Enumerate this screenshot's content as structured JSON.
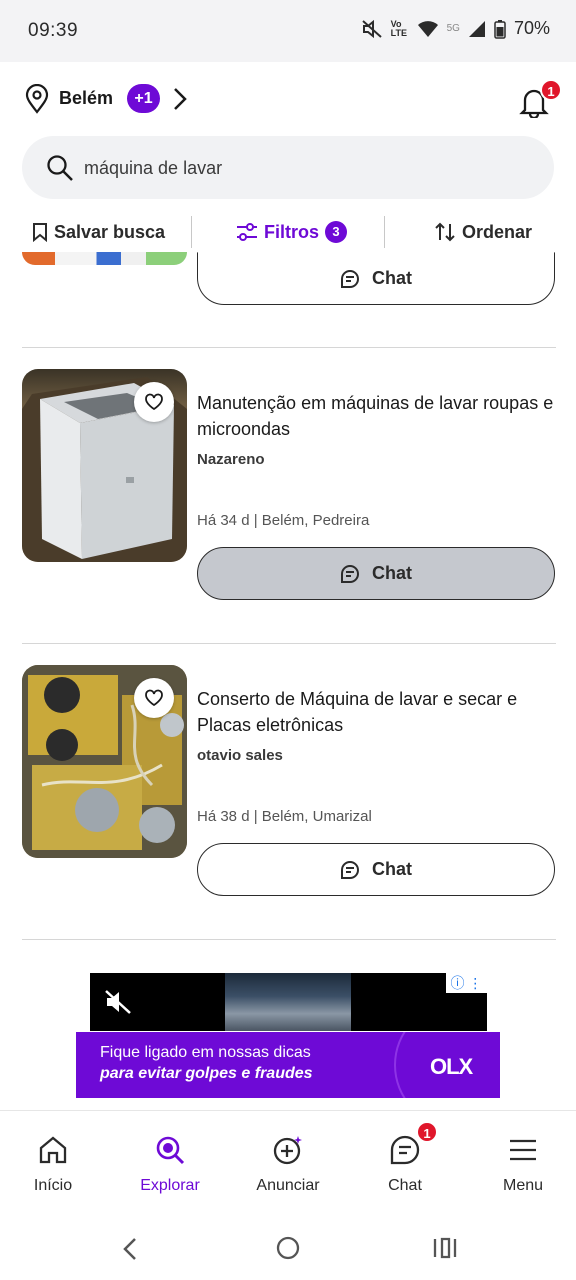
{
  "status_bar": {
    "time": "09:39",
    "network": "5G",
    "volte": "Vo LTE",
    "battery": "70%"
  },
  "header": {
    "location": "Belém",
    "extra_locations": "+1",
    "notification_count": "1"
  },
  "search": {
    "value": "máquina de lavar",
    "placeholder": "máquina de lavar"
  },
  "toolbar": {
    "save_search": "Salvar busca",
    "filters": "Filtros",
    "filters_count": "3",
    "sort": "Ordenar"
  },
  "listings": [
    {
      "chat_label": "Chat"
    },
    {
      "title": "Manutenção em máquinas de lavar roupas e microondas",
      "seller": "Nazareno",
      "meta": "Há 34 d | Belém, Pedreira",
      "chat_label": "Chat"
    },
    {
      "title": "Conserto de Máquina de lavar e secar e Placas eletrônicas",
      "seller": "otavio sales",
      "meta": "Há 38 d | Belém, Umarizal",
      "chat_label": "Chat"
    }
  ],
  "ad": {
    "line1": "Fique ligado em nossas dicas",
    "line2": "para evitar golpes e fraudes",
    "brand": "OLX"
  },
  "bottom_nav": {
    "items": [
      {
        "label": "Início",
        "icon": "home-icon"
      },
      {
        "label": "Explorar",
        "icon": "explore-icon"
      },
      {
        "label": "Anunciar",
        "icon": "add-ad-icon"
      },
      {
        "label": "Chat",
        "icon": "chat-icon",
        "badge": "1"
      },
      {
        "label": "Menu",
        "icon": "menu-icon"
      }
    ]
  },
  "colors": {
    "accent": "#6e0ad6",
    "badge": "#e0162b",
    "pressed_button": "#c5c8ce"
  }
}
